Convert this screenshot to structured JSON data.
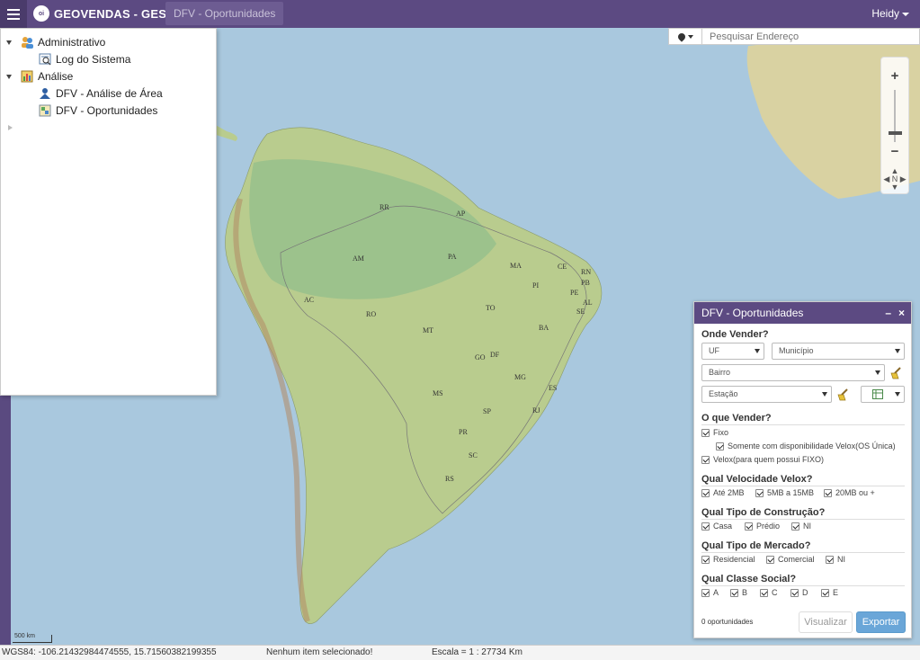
{
  "topbar": {
    "app_title": "GEOVENDAS - GESTOR",
    "logo_text": "oi",
    "active_tab": "DFV - Oportunidades",
    "user_name": "Heidy"
  },
  "search": {
    "placeholder": "Pesquisar Endereço"
  },
  "tree": {
    "items": [
      {
        "label": "Administrativo",
        "icon": "users-icon"
      },
      {
        "label": "Log do Sistema",
        "icon": "log-icon"
      },
      {
        "label": "Análise",
        "icon": "analysis-icon"
      },
      {
        "label": "DFV - Análise de Área",
        "icon": "area-analysis-icon"
      },
      {
        "label": "DFV - Oportunidades",
        "icon": "opportunities-icon"
      }
    ]
  },
  "map": {
    "states": [
      "RR",
      "AP",
      "AM",
      "PA",
      "MA",
      "CE",
      "RN",
      "PB",
      "PI",
      "PE",
      "AL",
      "SE",
      "AC",
      "RO",
      "TO",
      "BA",
      "MT",
      "GO",
      "DF",
      "MG",
      "ES",
      "MS",
      "SP",
      "RJ",
      "PR",
      "SC",
      "RS"
    ],
    "scale_label": "500 km"
  },
  "panel": {
    "title": "DFV - Oportunidades",
    "where_title": "Onde Vender?",
    "uf": "UF",
    "municipio": "Município",
    "bairro": "Bairro",
    "estacao": "Estação",
    "what_title": "O que Vender?",
    "fixo": "Fixo",
    "somente": "Somente com disponibilidade Velox(OS Única)",
    "velox": "Velox(para quem possui FIXO)",
    "speed_title": "Qual Velocidade Velox?",
    "speeds": [
      "Até 2MB",
      "5MB a 15MB",
      "20MB ou +"
    ],
    "construction_title": "Qual Tipo de Construção?",
    "constructions": [
      "Casa",
      "Prédio",
      "NI"
    ],
    "market_title": "Qual Tipo de Mercado?",
    "markets": [
      "Residencial",
      "Comercial",
      "NI"
    ],
    "social_title": "Qual Classe Social?",
    "classes": [
      "A",
      "B",
      "C",
      "D",
      "E"
    ],
    "count": "0 oportunidades",
    "visualizar": "Visualizar",
    "exportar": "Exportar"
  },
  "status": {
    "coords": "WGS84: -106.21432984474555, 15.71560382199355",
    "selection": "Nenhum item selecionado!",
    "scale": "Escala = 1 : 27734 Km"
  },
  "colors": {
    "brand": "#5c4a82",
    "export_button": "#6aa6d8",
    "ocean": "#a9c8de",
    "land": "#c8d69a"
  }
}
